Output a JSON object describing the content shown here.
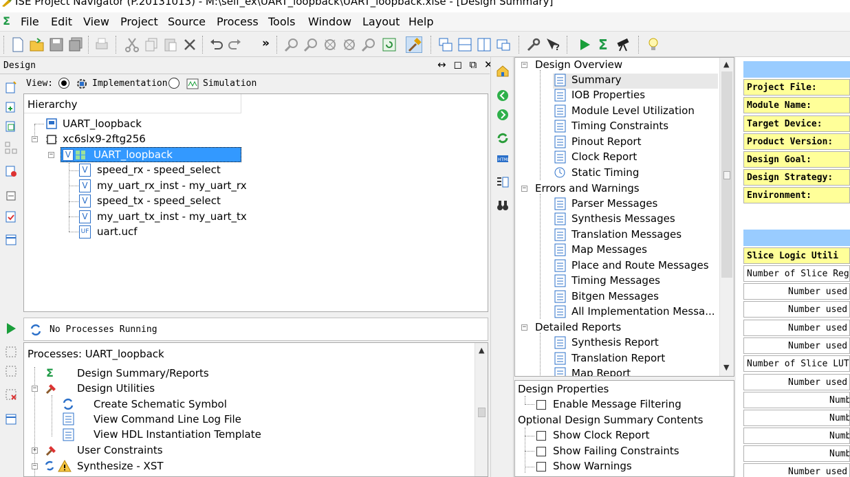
{
  "window": {
    "title": "ISE Project Navigator (P.20131013) - M:\\self_ex\\UART_loopback\\UART_loopback.xise - [Design Summary]"
  },
  "menu": [
    "File",
    "Edit",
    "View",
    "Project",
    "Source",
    "Process",
    "Tools",
    "Window",
    "Layout",
    "Help"
  ],
  "toolbar": {
    "overflow_label": "»"
  },
  "design_panel": {
    "title": "Design",
    "controls": "↔ ◻ ⧉ ✕",
    "view_label": "View:",
    "view_options": [
      "Implementation",
      "Simulation"
    ],
    "selected_view": "Implementation",
    "hierarchy_header": "Hierarchy",
    "tree": [
      "UART_loopback",
      "xc6slx9-2ftg256",
      "UART_loopback",
      "speed_rx - speed_select",
      "my_uart_rx_inst - my_uart_rx",
      "speed_tx - speed_select",
      "my_uart_tx_inst - my_uart_tx",
      "uart.ucf"
    ]
  },
  "process_panel": {
    "status": "No Processes Running",
    "header": "Processes: UART_loopback",
    "tree": [
      "Design Summary/Reports",
      "Design Utilities",
      "Create Schematic Symbol",
      "View Command Line Log File",
      "View HDL Instantiation Template",
      "User Constraints",
      "Synthesize - XST"
    ]
  },
  "overview": {
    "groups": [
      {
        "label": "Design Overview",
        "items": [
          "Summary",
          "IOB Properties",
          "Module Level Utilization",
          "Timing Constraints",
          "Pinout Report",
          "Clock Report",
          "Static Timing"
        ]
      },
      {
        "label": "Errors and Warnings",
        "items": [
          "Parser Messages",
          "Synthesis Messages",
          "Translation Messages",
          "Map Messages",
          "Place and Route Messages",
          "Timing Messages",
          "Bitgen Messages",
          "All Implementation Messa..."
        ]
      },
      {
        "label": "Detailed Reports",
        "items": [
          "Synthesis Report",
          "Translation Report",
          "Map Report"
        ]
      }
    ]
  },
  "properties": {
    "group1": "Design Properties",
    "enable_filtering": "Enable Message Filtering",
    "group2": "Optional Design Summary Contents",
    "options": [
      "Show Clock Report",
      "Show Failing Constraints",
      "Show Warnings"
    ]
  },
  "summary_table": {
    "labels": [
      "Project File:",
      "Module Name:",
      "Target Device:",
      "Product Version:",
      "Design Goal:",
      "Design Strategy:",
      "Environment:"
    ],
    "util_header": "Slice Logic Utili",
    "util_rows": [
      "Number of Slice Regi",
      "Number used",
      "Number used",
      "Number used",
      "Number used",
      "Number of Slice LUTs",
      "Number used",
      "Numb",
      "Numb",
      "Numb",
      "Numb",
      "Number used"
    ]
  },
  "colors": {
    "selection": "#3399ff",
    "table_label_bg": "#ffff99",
    "table_header_bg": "#99ccff"
  }
}
